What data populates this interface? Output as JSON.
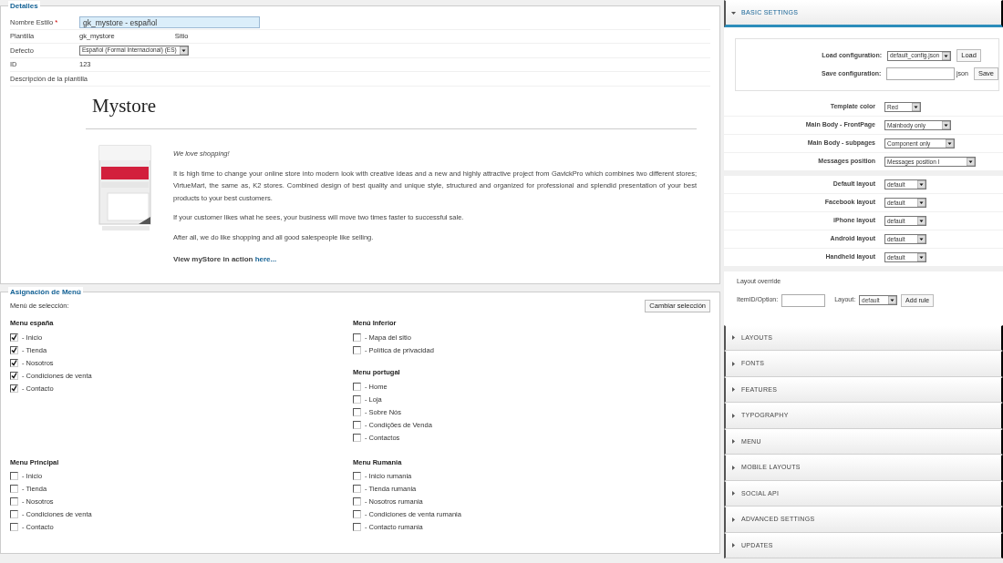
{
  "details": {
    "legend": "Detalles",
    "fields": [
      {
        "kind": "input",
        "label": "Nombre Estilo",
        "required_mark": "*",
        "value": "gk_mystore - español"
      },
      {
        "kind": "text",
        "label": "Plantilla",
        "value": "gk_mystore",
        "extra": "Sitio"
      },
      {
        "kind": "select",
        "label": "Defecto",
        "value": "Español (Formal Internacional) (ES)"
      },
      {
        "kind": "text",
        "label": "ID",
        "value": "123"
      },
      {
        "kind": "label",
        "label": "Descripción de la plantilla"
      }
    ],
    "description": {
      "title": "Mystore",
      "paragraphs": [
        {
          "kind": "italic",
          "text": "We love shopping!"
        },
        {
          "kind": "plain",
          "text": "It is high time to change your online store into modern look with creative ideas and a new and highly attractive project from GavickPro which combines two different stores; VirtueMart, the same as, K2 stores. Combined design of best quality and unique style, structured and organized for professional and splendid presentation of your best products to your best customers."
        },
        {
          "kind": "plain",
          "text": "If your customer likes what he sees, your business will move two times faster to successful sale."
        },
        {
          "kind": "plain",
          "text": "After all, we do like shopping and all good salespeople like selling."
        }
      ],
      "cta": {
        "text": "View myStore in action",
        "link": "here..."
      }
    }
  },
  "menu_assignment": {
    "legend": "Asignación de Menú",
    "selection_label": "Menú de selección:",
    "change_button": "Cambiar selección",
    "rows": [
      {
        "columns": [
          {
            "menus": [
              {
                "title": "Menu españa",
                "items": [
                  {
                    "label": "- Inicio",
                    "checked": true
                  },
                  {
                    "label": "- Tienda",
                    "checked": true
                  },
                  {
                    "label": "- Nosotros",
                    "checked": true
                  },
                  {
                    "label": "- Condiciones de venta",
                    "checked": true
                  },
                  {
                    "label": "- Contacto",
                    "checked": true
                  }
                ]
              }
            ]
          },
          {
            "menus": [
              {
                "title": "Menú Inferior",
                "items": [
                  {
                    "label": "- Mapa del sitio",
                    "checked": false
                  },
                  {
                    "label": "- Política de privacidad",
                    "checked": false
                  }
                ]
              },
              {
                "title": "Menu portugal",
                "items": [
                  {
                    "label": "- Home",
                    "checked": false
                  },
                  {
                    "label": "- Loja",
                    "checked": false
                  },
                  {
                    "label": "- Sobre Nós",
                    "checked": false
                  },
                  {
                    "label": "- Condições de Venda",
                    "checked": false
                  },
                  {
                    "label": "- Contactos",
                    "checked": false
                  }
                ]
              }
            ]
          }
        ]
      },
      {
        "columns": [
          {
            "menus": [
              {
                "title": "Menu Principal",
                "items": [
                  {
                    "label": "- Inicio",
                    "checked": false
                  },
                  {
                    "label": "- Tienda",
                    "checked": false
                  },
                  {
                    "label": "- Nosotros",
                    "checked": false
                  },
                  {
                    "label": "- Condiciones de venta",
                    "checked": false
                  },
                  {
                    "label": "- Contacto",
                    "checked": false
                  }
                ]
              }
            ]
          },
          {
            "menus": [
              {
                "title": "Menu Rumania",
                "items": [
                  {
                    "label": "- Inicio rumania",
                    "checked": false
                  },
                  {
                    "label": "- Tienda rumania",
                    "checked": false
                  },
                  {
                    "label": "- Nosotros rumania",
                    "checked": false
                  },
                  {
                    "label": "- Condiciones de venta rumania",
                    "checked": false
                  },
                  {
                    "label": "- Contacto rumania",
                    "checked": false
                  }
                ]
              }
            ]
          }
        ]
      }
    ]
  },
  "basic_settings": {
    "title": "BASIC SETTINGS",
    "expanded": true,
    "config": {
      "load_label": "Load configuration:",
      "load_value": "default_config.json",
      "load_button": "Load",
      "save_label": "Save configuration:",
      "save_suffix": "json",
      "save_button": "Save"
    },
    "groups": [
      [
        {
          "label": "Template color",
          "value": "Red"
        },
        {
          "label": "Main Body - FrontPage",
          "value": "Mainbody only"
        },
        {
          "label": "Main Body - subpages",
          "value": "Component only"
        },
        {
          "label": "Messages position",
          "value": "Messages position I"
        }
      ],
      [
        {
          "label": "Default layout",
          "value": "default"
        },
        {
          "label": "Facebook layout",
          "value": "default"
        },
        {
          "label": "iPhone layout",
          "value": "default"
        },
        {
          "label": "Android layout",
          "value": "default"
        },
        {
          "label": "Handheld layout",
          "value": "default"
        }
      ]
    ],
    "layout_override": {
      "title": "Layout override",
      "itemid_label": "ItemID/Option:",
      "layout_label": "Layout:",
      "layout_value": "default",
      "add_button": "Add rule"
    }
  },
  "sections": [
    {
      "title": "LAYOUTS",
      "expanded": false
    },
    {
      "title": "FONTS",
      "expanded": false
    },
    {
      "title": "FEATURES",
      "expanded": false
    },
    {
      "title": "TYPOGRAPHY",
      "expanded": false
    },
    {
      "title": "MENU",
      "expanded": false
    },
    {
      "title": "MOBILE LAYOUTS",
      "expanded": false
    },
    {
      "title": "SOCIAL API",
      "expanded": false
    },
    {
      "title": "ADVANCED SETTINGS",
      "expanded": false
    },
    {
      "title": "UPDATES",
      "expanded": false
    }
  ]
}
